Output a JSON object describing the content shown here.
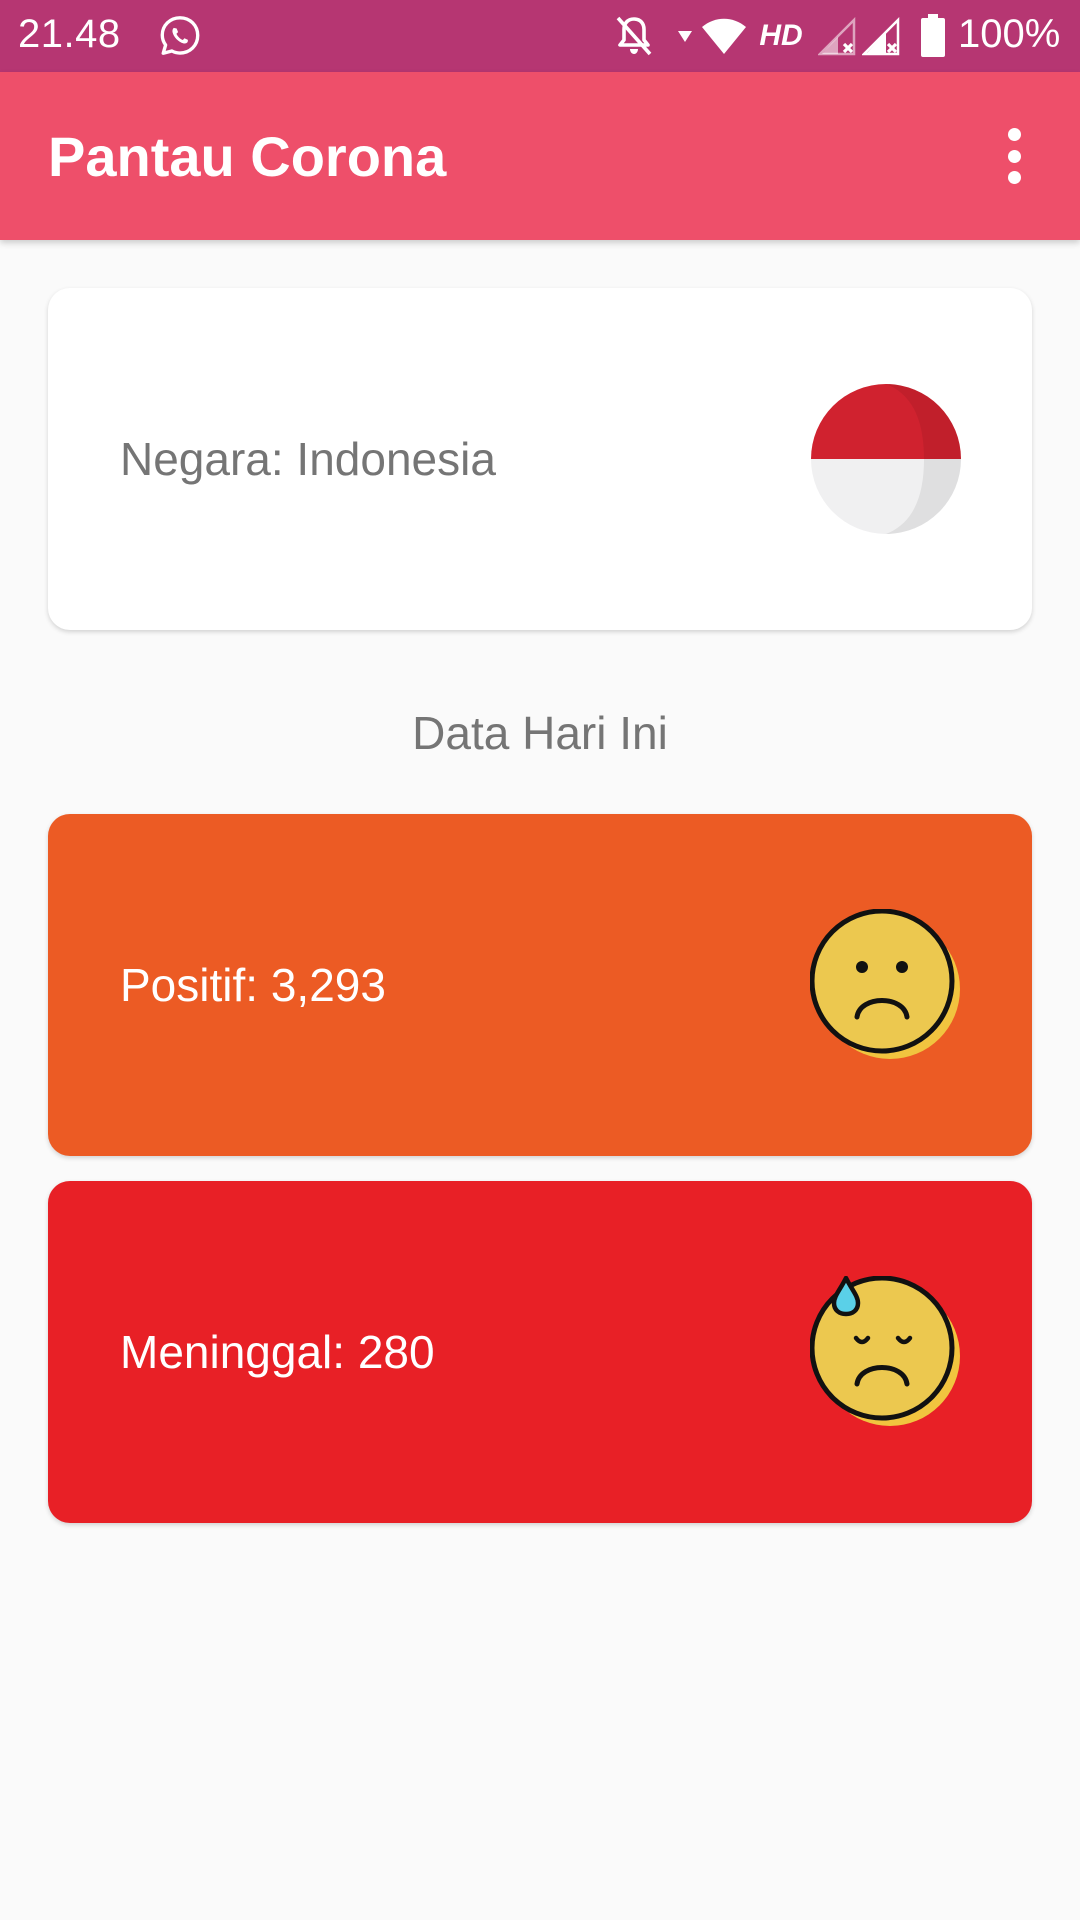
{
  "status_bar": {
    "time": "21.48",
    "network_label": "HD",
    "battery": "100%",
    "icons": [
      "whatsapp-icon",
      "mute-icon",
      "data-arrow-icon",
      "wifi-icon",
      "signal-icon",
      "signal-icon",
      "battery-icon"
    ]
  },
  "app_bar": {
    "title": "Pantau Corona",
    "menu_icon": "more-vertical-icon"
  },
  "country_card": {
    "label": "Negara: Indonesia",
    "icon": "indonesia-flag-icon"
  },
  "section": {
    "title": "Data Hari Ini"
  },
  "positive_card": {
    "label": "Positif: 3,293",
    "icon": "frowning-face-icon"
  },
  "death_card": {
    "label": "Meninggal: 280",
    "icon": "sad-sweat-face-icon"
  },
  "colors": {
    "status_bar": "#b63672",
    "app_bar": "#ee4f6a",
    "positive": "#ec5b24",
    "death": "#e82026",
    "background": "#fafafa"
  }
}
